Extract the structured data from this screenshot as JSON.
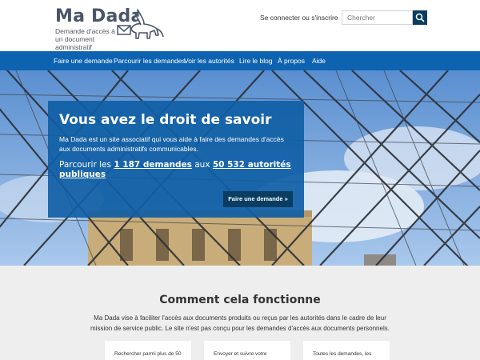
{
  "header": {
    "logo_title": "Ma Dada",
    "logo_tagline": "Demande d'accès à un document administratif",
    "login_link": "Se connecter ou s'inscrire",
    "search_placeholder": "Chercher"
  },
  "nav": {
    "items": [
      {
        "label": "Faire une demande"
      },
      {
        "label": "Parcourir les demandes"
      },
      {
        "label": "Voir les autorités"
      },
      {
        "label": "Lire le blog"
      },
      {
        "label": "À propos"
      },
      {
        "label": "Aide"
      }
    ]
  },
  "hero": {
    "title": "Vous avez le droit de savoir",
    "description": "Ma Dada est un site associatif qui vous aide à faire des demandes d'accès aux documents administratifs communicables.",
    "stats_prefix": "Parcourir les ",
    "requests_count": "1 187 demandes",
    "stats_middle": " aux ",
    "authorities_count": "50 532 autorités publiques",
    "cta_label": "Faire une demande »"
  },
  "how": {
    "title": "Comment cela fonctionne",
    "description": "Ma Dada vise à faciliter l'accès aux documents produits ou reçus par les autorités dans le cadre de leur mission de service public. Le site n'est pas conçu pour les demandes d'accès aux documents personnels.",
    "cards": [
      {
        "text": "Rechercher parmi plus de 50"
      },
      {
        "text": "Envoyer et suivre votre"
      },
      {
        "text": "Toutes les demandes, les"
      }
    ]
  },
  "colors": {
    "nav_blue": "#0e63b0",
    "dark_navy": "#0a3d62",
    "hero_box": "#105ea5"
  }
}
